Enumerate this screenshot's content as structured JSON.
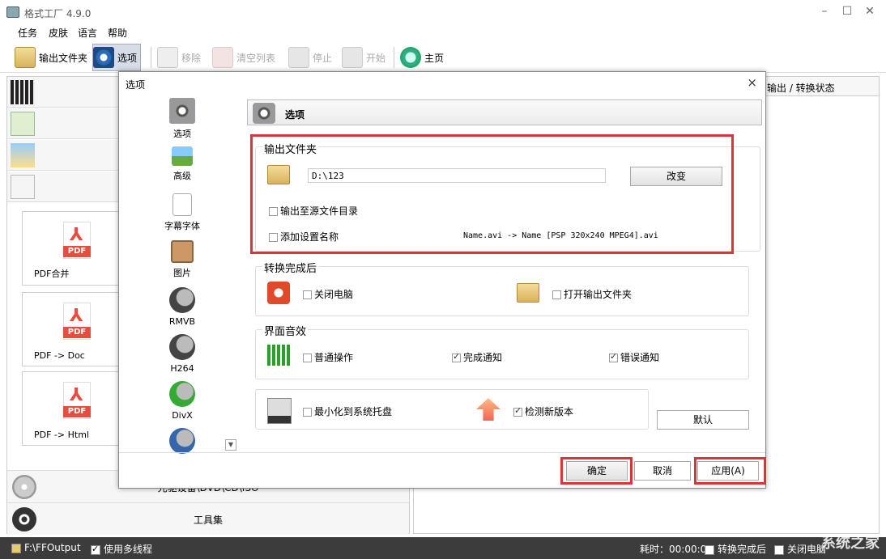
{
  "window": {
    "title": "格式工厂 4.9.0",
    "min": "–",
    "max": "☐",
    "close": "✕"
  },
  "menu": {
    "items": [
      "任务",
      "皮肤",
      "语言",
      "帮助"
    ]
  },
  "toolbar": {
    "output_folder": "输出文件夹",
    "options": "选项",
    "remove": "移除",
    "clear_list": "清空列表",
    "stop": "停止",
    "start": "开始",
    "home": "主页"
  },
  "left_panel": {
    "tiles": [
      {
        "label": "PDF合并",
        "pdf": "PDF"
      },
      {
        "label": "PDF -> Doc",
        "pdf": "PDF"
      },
      {
        "label": "PDF -> Html",
        "pdf": "PDF"
      }
    ],
    "bottom_items": [
      "光驱设备\\DVD\\CD\\ISO",
      "工具集"
    ],
    "pdf_mark": "⅄"
  },
  "right_panel": {
    "header": "输出 / 转换状态"
  },
  "statusbar": {
    "output_path": "F:\\FFOutput",
    "multithread": "使用多线程",
    "elapsed": "耗时：00:00:00",
    "after_convert": "转换完成后",
    "partial": "关闭电脑",
    "watermark": "系统之家"
  },
  "dialog": {
    "title": "选项",
    "close": "×",
    "sidebar": [
      "选项",
      "高级",
      "字幕字体",
      "图片",
      "RMVB",
      "H264",
      "DivX",
      ""
    ],
    "scroll_down": "▼",
    "header": "选项",
    "output_group": {
      "title": "输出文件夹",
      "path_value": "D:\\123",
      "change_button": "改变",
      "output_to_source": "输出至源文件目录",
      "add_setting_name": "添加设置名称",
      "name_example": "Name.avi  -> Name [PSP 320x240 MPEG4].avi"
    },
    "after_group": {
      "title": "转换完成后",
      "shutdown": "关闭电脑",
      "open_folder": "打开输出文件夹"
    },
    "sound_group": {
      "title": "界面音效",
      "normal": "普通操作",
      "complete": "完成通知",
      "error": "错误通知"
    },
    "misc_group": {
      "minimize_tray": "最小化到系统托盘",
      "check_update": "检测新版本"
    },
    "default_button": "默认",
    "ok_button": "确定",
    "cancel_button": "取消",
    "apply_button": "应用(A)"
  },
  "colors": {
    "highlight": "#d9343b",
    "statusbar": "#3c3c3c",
    "pdf_red": "#e74c3c"
  }
}
